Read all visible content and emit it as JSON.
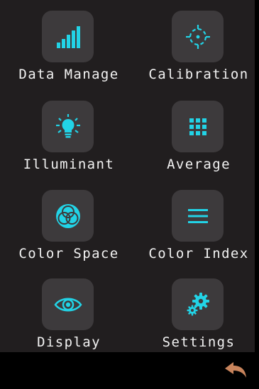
{
  "accent_color": "#22d3e6",
  "tile_color": "#3d3a3c",
  "panel_color": "#211e1f",
  "back_icon_color": "#c8845c",
  "menu": [
    {
      "label": "Data Manage",
      "icon": "signal-bars-icon"
    },
    {
      "label": "Calibration",
      "icon": "crosshair-icon"
    },
    {
      "label": "Illuminant",
      "icon": "lightbulb-icon"
    },
    {
      "label": "Average",
      "icon": "grid-icon"
    },
    {
      "label": "Color Space",
      "icon": "color-circles-icon"
    },
    {
      "label": "Color Index",
      "icon": "list-lines-icon"
    },
    {
      "label": "Display",
      "icon": "eye-icon"
    },
    {
      "label": "Settings",
      "icon": "gears-icon"
    }
  ],
  "back": {
    "icon": "back-arrow-icon"
  }
}
